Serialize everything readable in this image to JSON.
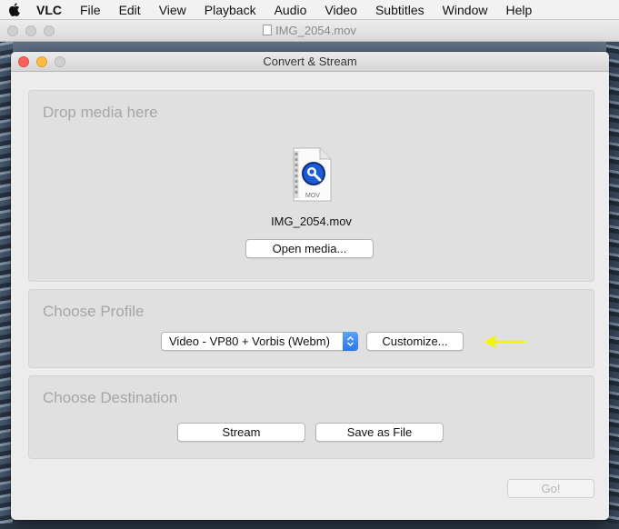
{
  "menubar": {
    "app": "VLC",
    "items": [
      "File",
      "Edit",
      "View",
      "Playback",
      "Audio",
      "Video",
      "Subtitles",
      "Window",
      "Help"
    ]
  },
  "background_window": {
    "title": "IMG_2054.mov"
  },
  "dialog": {
    "title": "Convert & Stream",
    "drop": {
      "heading": "Drop media here",
      "file_type": "MOV",
      "file_name": "IMG_2054.mov",
      "open_button": "Open media..."
    },
    "profile": {
      "heading": "Choose Profile",
      "selected": "Video - VP80 + Vorbis (Webm)",
      "customize_button": "Customize..."
    },
    "destination": {
      "heading": "Choose Destination",
      "stream_button": "Stream",
      "save_button": "Save as File"
    },
    "go_button": "Go!"
  },
  "colors": {
    "close": "#fc605c",
    "minimize": "#fdbc40",
    "select_accent": "#2a76e6",
    "annotation_arrow": "#f4f40a"
  },
  "icons": [
    "apple-icon",
    "document-icon",
    "quicktime-file-icon",
    "popup-arrows-icon",
    "annotation-arrow-icon"
  ]
}
